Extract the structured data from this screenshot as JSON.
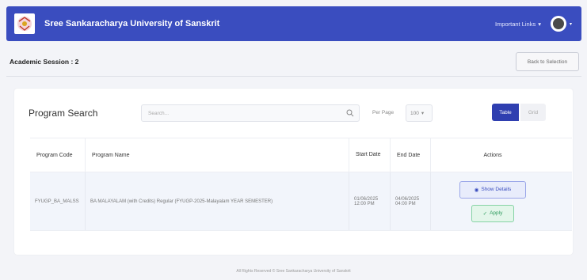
{
  "header": {
    "university_name": "Sree Sankaracharya University of Sanskrit",
    "important_links": "Important Links",
    "logo_icon": "university-logo",
    "avatar_icon": "user-avatar-icon",
    "brand_color": "#3a4dbf"
  },
  "session": {
    "label": "Academic Session : 2",
    "back_button": "Back to Selection"
  },
  "search": {
    "title": "Program Search",
    "placeholder": "Search...",
    "per_page_label": "Per Page",
    "per_page_value": "100",
    "view_table": "Table",
    "view_grid": "Grid"
  },
  "table": {
    "headers": {
      "code": "Program Code",
      "name": "Program Name",
      "start": "Start Date",
      "end": "End Date",
      "actions": "Actions"
    },
    "rows": [
      {
        "code": "FYUGP_BA_MALSS",
        "name": "BA MALAYALAM (with Credits) Regular (FYUGP-2025-Malayalam YEAR SEMESTER)",
        "start_date": "01/06/2025",
        "start_time": "12:00 PM",
        "end_date": "04/06/2025",
        "end_time": "04:00 PM",
        "show_details": "Show Details",
        "apply": "Apply"
      }
    ]
  },
  "footer": {
    "text": "All Rights Reserved © Sree Sankaracharya University of Sanskrit"
  }
}
